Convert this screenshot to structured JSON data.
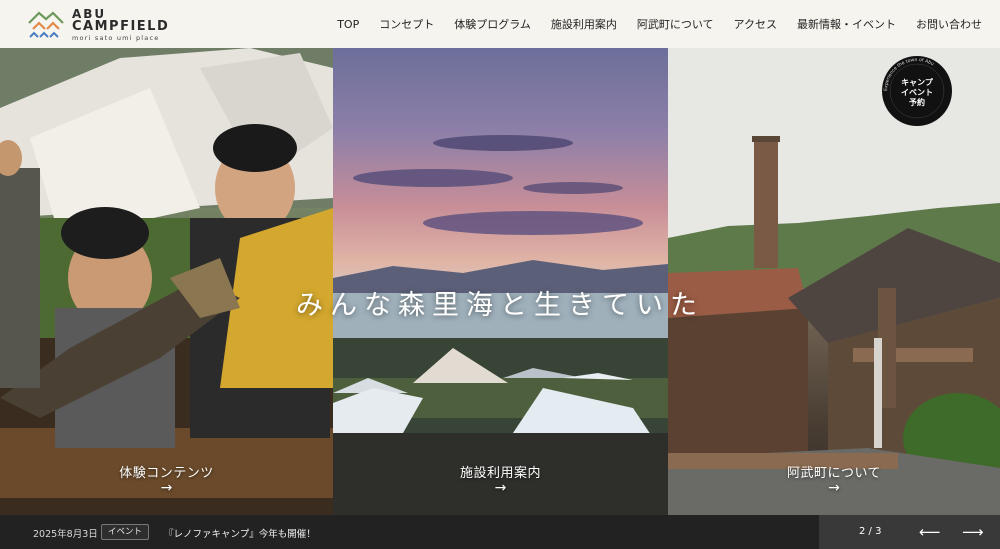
{
  "logo": {
    "line1": "ABU",
    "line2": "CAMPFIELD",
    "line3": "mori sato umi place"
  },
  "nav": [
    {
      "label": "TOP"
    },
    {
      "label": "コンセプト"
    },
    {
      "label": "体験プログラム"
    },
    {
      "label": "施設利用案内"
    },
    {
      "label": "阿武町について"
    },
    {
      "label": "アクセス"
    },
    {
      "label": "最新情報・イベント"
    },
    {
      "label": "お問い合わせ"
    }
  ],
  "hero": {
    "tagline": "みんな森里海と生きていた",
    "panels": [
      {
        "label": "体験コンテンツ",
        "arrow": "→"
      },
      {
        "label": "施設利用案内",
        "arrow": "→"
      },
      {
        "label": "阿武町について",
        "arrow": "→"
      }
    ]
  },
  "badge": {
    "line1": "キャンプ",
    "line2": "イベント",
    "line3": "予約",
    "ring_text": "Experience the town of Abu"
  },
  "news": {
    "date": "2025年8月3日",
    "tag": "イベント",
    "title": "『レノファキャンプ』今年も開催！"
  },
  "pager": {
    "count": "2 / 3",
    "prev": "⟵",
    "next": "⟶"
  },
  "colors": {
    "header_bg": "#f6f4ef",
    "bottom_bg": "#222222",
    "pager_bg": "#393939",
    "logo_green": "#6b9a5a",
    "logo_orange": "#e28a4a",
    "logo_blue": "#4a7cc0"
  }
}
